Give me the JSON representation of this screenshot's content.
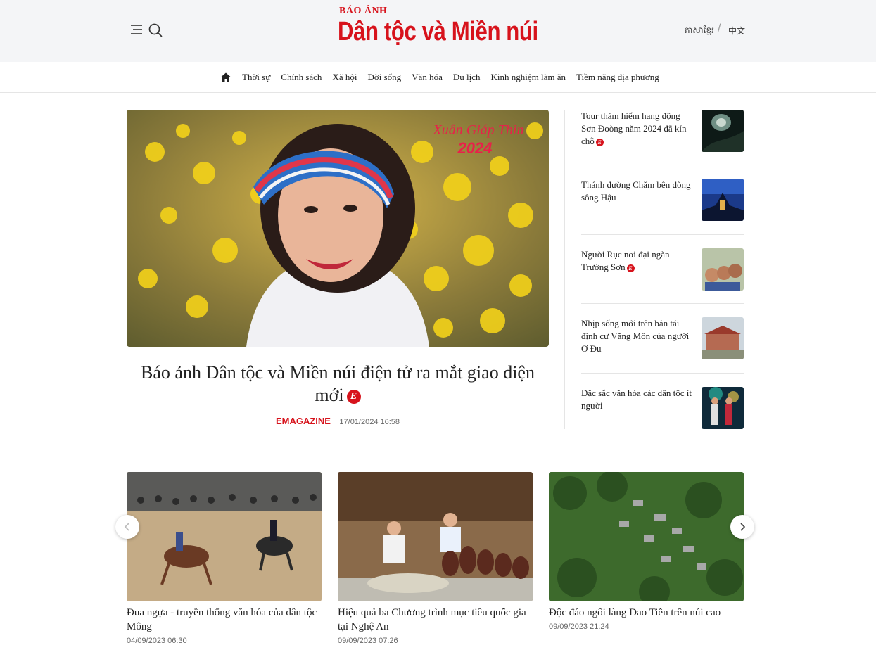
{
  "header": {
    "brand_kicker": "BÁO ẢNH",
    "brand_name": "Dân tộc và Miền núi",
    "languages": [
      "ភាសាខ្មែរ",
      "中文"
    ],
    "lang_separator": "/"
  },
  "nav": {
    "items": [
      "Thời sự",
      "Chính sách",
      "Xã hội",
      "Đời sống",
      "Văn hóa",
      "Du lịch",
      "Kinh nghiệm làm ăn",
      "Tiềm năng địa phương"
    ]
  },
  "featured": {
    "image_caption_line1": "Xuân Giáp Thìn",
    "image_caption_line2": "2024",
    "title": "Báo ảnh Dân tộc và Miền núi điện tử ra mắt giao diện mới",
    "category": "EMAGAZINE",
    "date": "17/01/2024 16:58",
    "badge": "E"
  },
  "side_list": [
    {
      "title": "Tour thám hiểm hang động Sơn Đoòng năm 2024 đã kín chỗ",
      "emagazine": true
    },
    {
      "title": "Thánh đường Chăm bên dòng sông Hậu",
      "emagazine": false
    },
    {
      "title": "Người Rục nơi đại ngàn Trường Sơn",
      "emagazine": true
    },
    {
      "title": "Nhịp sống mới trên bản tái định cư Văng Môn của người Ơ Đu",
      "emagazine": false
    },
    {
      "title": "Đặc sắc văn hóa các dân tộc ít người",
      "emagazine": false
    }
  ],
  "carousel": [
    {
      "title": "Đua ngựa - truyền thống văn hóa của dân tộc Mông",
      "date": "04/09/2023 06:30"
    },
    {
      "title": "Hiệu quả ba Chương trình mục tiêu quốc gia tại Nghệ An",
      "date": "09/09/2023 07:26"
    },
    {
      "title": "Độc đáo ngôi làng Dao Tiền trên núi cao",
      "date": "09/09/2023 21:24"
    }
  ],
  "colors": {
    "brand_red": "#d7131c",
    "topbar_bg": "#f4f5f7",
    "text": "#222222",
    "muted": "#666666"
  }
}
